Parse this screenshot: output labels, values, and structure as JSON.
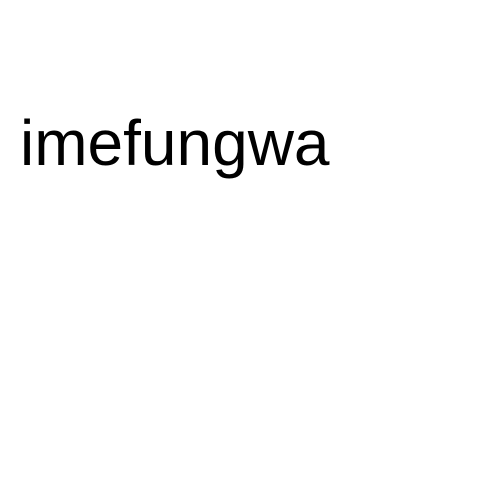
{
  "text": "imefungwa",
  "colors": {
    "background": "#ffffff",
    "text": "#000000"
  }
}
